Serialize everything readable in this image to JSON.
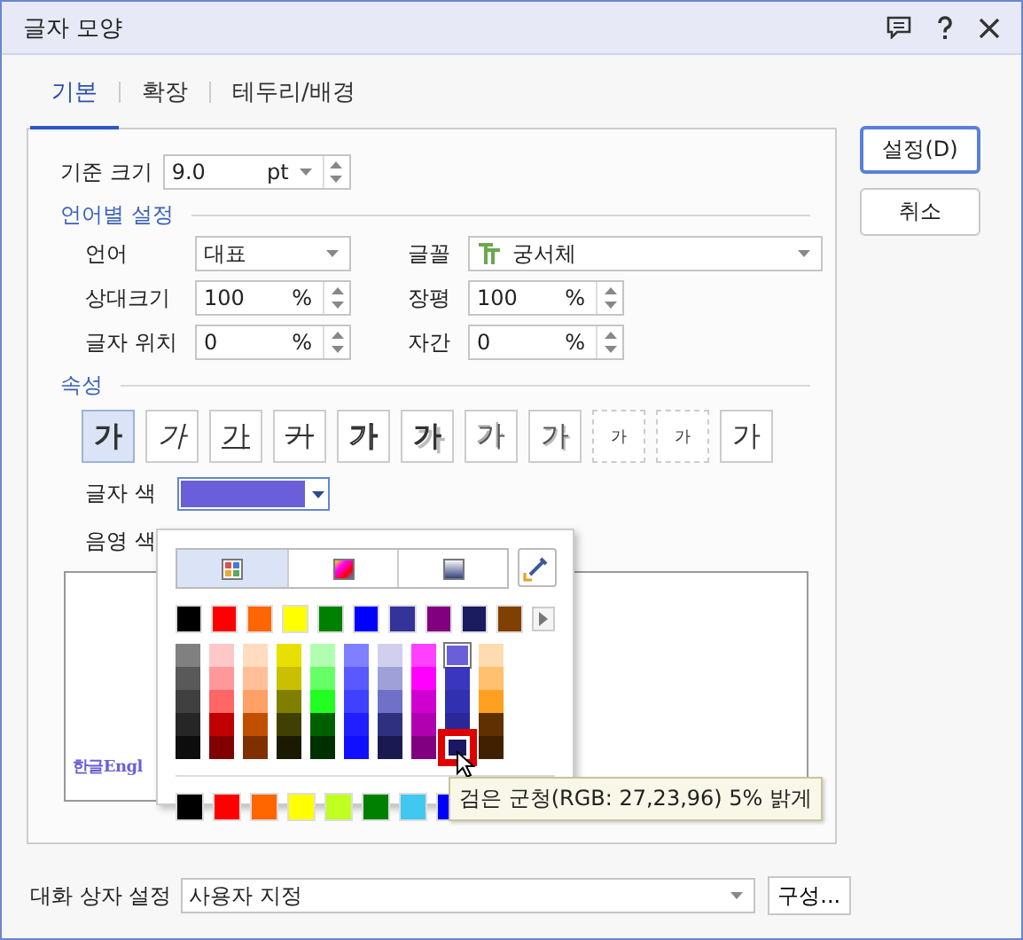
{
  "window": {
    "title": "글자 모양"
  },
  "tabs": [
    {
      "label": "기본",
      "selected": true
    },
    {
      "label": "확장",
      "selected": false
    },
    {
      "label": "테두리/배경",
      "selected": false
    }
  ],
  "base_size": {
    "label": "기준 크기",
    "value": "9.0",
    "unit": "pt"
  },
  "language_section": {
    "title": "언어별 설정",
    "language": {
      "label": "언어",
      "value": "대표"
    },
    "font": {
      "label": "글꼴",
      "value": "궁서체"
    },
    "fields": [
      {
        "label": "상대크기",
        "value": "100",
        "unit": "%"
      },
      {
        "label": "장평",
        "value": "100",
        "unit": "%"
      },
      {
        "label": "글자 위치",
        "value": "0",
        "unit": "%"
      },
      {
        "label": "자간",
        "value": "0",
        "unit": "%"
      }
    ]
  },
  "attributes": {
    "title": "속성",
    "buttons": [
      {
        "kind": "bold",
        "label": "가",
        "selected": true
      },
      {
        "kind": "italic",
        "label": "가",
        "selected": false
      },
      {
        "kind": "underline",
        "label": "가",
        "selected": false
      },
      {
        "kind": "strike",
        "label": "가",
        "selected": false
      },
      {
        "kind": "outline",
        "label": "가",
        "selected": false
      },
      {
        "kind": "shadow",
        "label": "가",
        "selected": false
      },
      {
        "kind": "emboss",
        "label": "가",
        "selected": false
      },
      {
        "kind": "engrave",
        "label": "가",
        "selected": false
      },
      {
        "kind": "superscript",
        "label": "가",
        "selected": false
      },
      {
        "kind": "subscript",
        "label": "가",
        "selected": false
      },
      {
        "kind": "normal",
        "label": "가",
        "selected": false
      }
    ]
  },
  "text_color": {
    "label": "글자 색",
    "color": "#6a5fd8"
  },
  "shade_color": {
    "label": "음영 색"
  },
  "preview": {
    "text": "한글Engl"
  },
  "color_popup": {
    "tabs": [
      {
        "kind": "palette",
        "selected": true
      },
      {
        "kind": "spectrum",
        "selected": false
      },
      {
        "kind": "gradient",
        "selected": false
      }
    ],
    "basic_colors": [
      {
        "color": "#000000"
      },
      {
        "color": "#ff0000"
      },
      {
        "color": "#ff6600"
      },
      {
        "color": "#ffff00"
      },
      {
        "color": "#008000"
      },
      {
        "color": "#0000ff"
      },
      {
        "color": "#333399"
      },
      {
        "color": "#800080"
      },
      {
        "color": "#1b1b60"
      },
      {
        "color": "#804000"
      }
    ],
    "shades": [
      [
        {
          "color": "#808080",
          "selected": false,
          "hovered": false
        },
        {
          "color": "#ffc8c8",
          "selected": false,
          "hovered": false
        },
        {
          "color": "#ffdcc0",
          "selected": false,
          "hovered": false
        },
        {
          "color": "#e8e000",
          "selected": false,
          "hovered": false
        },
        {
          "color": "#b0ffb0",
          "selected": false,
          "hovered": false
        },
        {
          "color": "#7f7fff",
          "selected": false,
          "hovered": false
        },
        {
          "color": "#d0d0ee",
          "selected": false,
          "hovered": false
        },
        {
          "color": "#ff40ff",
          "selected": false,
          "hovered": false
        },
        {
          "color": "#6a5fd8",
          "selected": true,
          "hovered": false
        },
        {
          "color": "#ffdcb0",
          "selected": false,
          "hovered": false
        }
      ],
      [
        {
          "color": "#595959",
          "selected": false,
          "hovered": false
        },
        {
          "color": "#ff9999",
          "selected": false,
          "hovered": false
        },
        {
          "color": "#ffc099",
          "selected": false,
          "hovered": false
        },
        {
          "color": "#c8c000",
          "selected": false,
          "hovered": false
        },
        {
          "color": "#66ff66",
          "selected": false,
          "hovered": false
        },
        {
          "color": "#5959ff",
          "selected": false,
          "hovered": false
        },
        {
          "color": "#a0a0d8",
          "selected": false,
          "hovered": false
        },
        {
          "color": "#ff00ff",
          "selected": false,
          "hovered": false
        },
        {
          "color": "#3a36c0",
          "selected": false,
          "hovered": false
        },
        {
          "color": "#ffc070",
          "selected": false,
          "hovered": false
        }
      ],
      [
        {
          "color": "#404040",
          "selected": false,
          "hovered": false
        },
        {
          "color": "#ff6666",
          "selected": false,
          "hovered": false
        },
        {
          "color": "#ffa066",
          "selected": false,
          "hovered": false
        },
        {
          "color": "#808000",
          "selected": false,
          "hovered": false
        },
        {
          "color": "#20ff20",
          "selected": false,
          "hovered": false
        },
        {
          "color": "#4040ff",
          "selected": false,
          "hovered": false
        },
        {
          "color": "#7070c8",
          "selected": false,
          "hovered": false
        },
        {
          "color": "#d000d0",
          "selected": false,
          "hovered": false
        },
        {
          "color": "#3030b0",
          "selected": false,
          "hovered": false
        },
        {
          "color": "#ffa020",
          "selected": false,
          "hovered": false
        }
      ],
      [
        {
          "color": "#262626",
          "selected": false,
          "hovered": false
        },
        {
          "color": "#c00000",
          "selected": false,
          "hovered": false
        },
        {
          "color": "#c05000",
          "selected": false,
          "hovered": false
        },
        {
          "color": "#404000",
          "selected": false,
          "hovered": false
        },
        {
          "color": "#006000",
          "selected": false,
          "hovered": false
        },
        {
          "color": "#2020ff",
          "selected": false,
          "hovered": false
        },
        {
          "color": "#303080",
          "selected": false,
          "hovered": false
        },
        {
          "color": "#b000b0",
          "selected": false,
          "hovered": false
        },
        {
          "color": "#2a2898",
          "selected": false,
          "hovered": false
        },
        {
          "color": "#603000",
          "selected": false,
          "hovered": false
        }
      ],
      [
        {
          "color": "#0d0d0d",
          "selected": false,
          "hovered": false
        },
        {
          "color": "#800000",
          "selected": false,
          "hovered": false
        },
        {
          "color": "#803000",
          "selected": false,
          "hovered": false
        },
        {
          "color": "#1a1a00",
          "selected": false,
          "hovered": false
        },
        {
          "color": "#003000",
          "selected": false,
          "hovered": false
        },
        {
          "color": "#1010ff",
          "selected": false,
          "hovered": false
        },
        {
          "color": "#1a1a50",
          "selected": false,
          "hovered": false
        },
        {
          "color": "#800080",
          "selected": false,
          "hovered": false
        },
        {
          "color": "#1b1760",
          "selected": false,
          "hovered": true
        },
        {
          "color": "#402000",
          "selected": false,
          "hovered": false
        }
      ]
    ],
    "recent_colors": [
      {
        "color": "#000000"
      },
      {
        "color": "#ff0000"
      },
      {
        "color": "#ff6600"
      },
      {
        "color": "#ffff00"
      },
      {
        "color": "#c0ff20"
      },
      {
        "color": "#008000"
      },
      {
        "color": "#40c8f0"
      },
      {
        "color": "#0000ff"
      }
    ],
    "tooltip": "검은 군청(RGB: 27,23,96) 5% 밝게"
  },
  "buttons": [
    {
      "label": "설정(D)",
      "kind": "default"
    },
    {
      "label": "취소",
      "kind": "normal"
    }
  ],
  "dialog_settings": {
    "label": "대화 상자 설정",
    "value": "사용자 지정",
    "button": "구성..."
  }
}
